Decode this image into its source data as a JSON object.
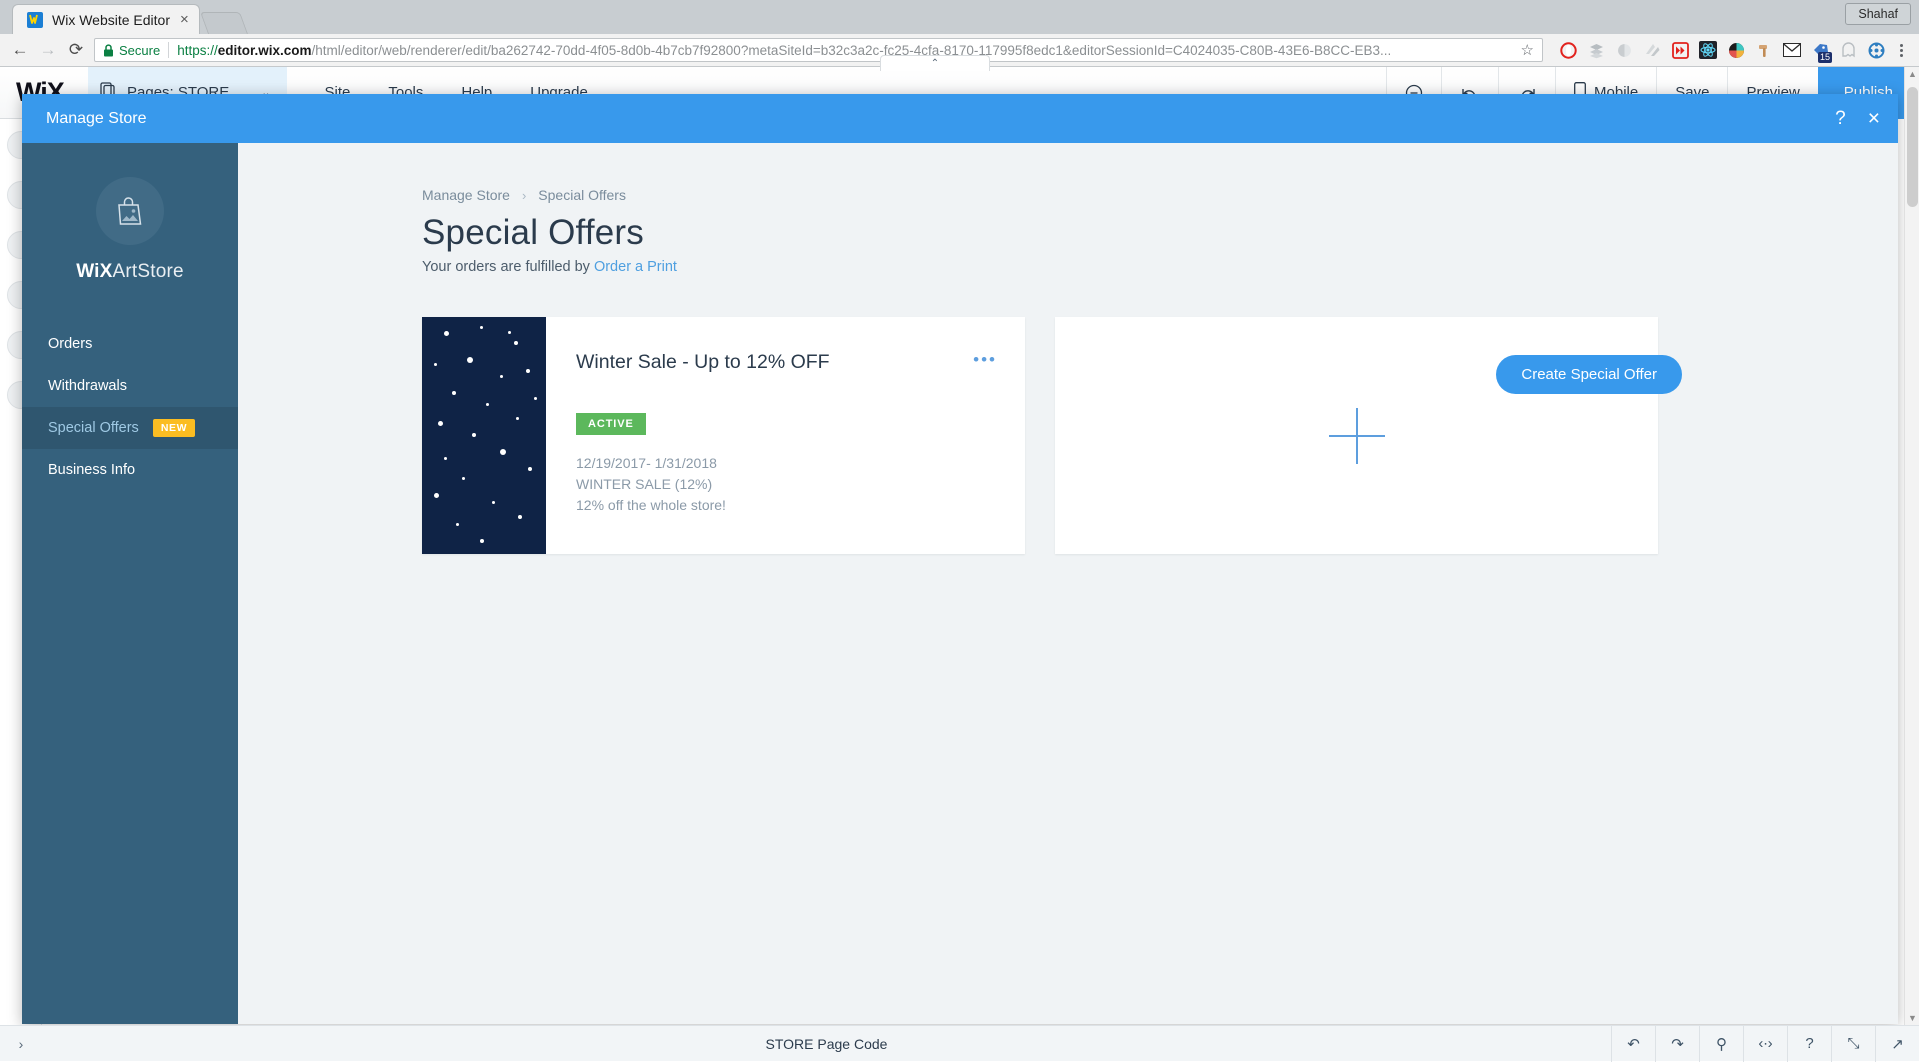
{
  "browser": {
    "tab": {
      "title": "Wix Website Editor",
      "favicon": "wix-favicon",
      "close": "×"
    },
    "new_tab_label": "",
    "profile": "Shahaf",
    "nav": {
      "back": "←",
      "forward": "→",
      "reload": "⟳"
    },
    "omnibox": {
      "secure_label": "Secure",
      "lock": "lock-icon",
      "url_scheme": "https://",
      "url_host": "editor.wix.com",
      "url_path": "/html/editor/web/renderer/edit/ba262742-70dd-4f05-8d0b-4b7cb7f92800?metaSiteId=b32c3a2c-fc25-4cfa-8170-117995f8edc1&editorSessionId=C4024035-C80B-43E6-B8CC-EB3...",
      "bookmark": "☆"
    },
    "extensions": [
      {
        "name": "opera-touch-icon"
      },
      {
        "name": "layers-icon"
      },
      {
        "name": "moon-icon"
      },
      {
        "name": "pages-icon"
      },
      {
        "name": "fast-forward-icon"
      },
      {
        "name": "react-devtools-icon"
      },
      {
        "name": "color-wheel-icon"
      },
      {
        "name": "hammer-icon"
      },
      {
        "name": "mail-icon"
      },
      {
        "name": "tag-icon",
        "badge": "15"
      },
      {
        "name": "ghost-icon"
      },
      {
        "name": "wheel-icon"
      }
    ],
    "menu": "chrome-menu-icon"
  },
  "editor": {
    "logo": "WiX",
    "pages_label": "Pages: STORE",
    "pages_chevron": "⌄",
    "menus": [
      "Site",
      "Tools",
      "Help",
      "Upgrade"
    ],
    "toolbar_handle": "⌃",
    "right_tools": [
      {
        "name": "zoom-out-icon",
        "label": ""
      },
      {
        "name": "undo-icon",
        "label": ""
      },
      {
        "name": "redo-icon",
        "label": ""
      },
      {
        "name": "mobile-icon",
        "label": "Mobile"
      },
      {
        "name": "save-button",
        "label": "Save"
      },
      {
        "name": "preview-button",
        "label": "Preview"
      }
    ],
    "publish_label": "Publish"
  },
  "modal": {
    "title": "Manage Store",
    "help_icon": "?",
    "close_icon": "×"
  },
  "sidebar": {
    "avatar_icon": "shopping-bag-icon",
    "brand_bold": "WiX",
    "brand_light": "ArtStore",
    "items": [
      {
        "label": "Orders",
        "active": false,
        "badge": null
      },
      {
        "label": "Withdrawals",
        "active": false,
        "badge": null
      },
      {
        "label": "Special Offers",
        "active": true,
        "badge": "NEW"
      },
      {
        "label": "Business Info",
        "active": false,
        "badge": null
      }
    ]
  },
  "content": {
    "breadcrumb": {
      "parent": "Manage Store",
      "separator": "›",
      "current": "Special Offers"
    },
    "page_title": "Special Offers",
    "subtitle_prefix": "Your orders are fulfilled by ",
    "subtitle_link": "Order a Print",
    "create_button": "Create Special Offer",
    "offers": [
      {
        "title": "Winter Sale - Up to 12% OFF",
        "menu_icon": "•••",
        "status": "ACTIVE",
        "status_color": "#5cb85c",
        "date_range": "12/19/2017- 1/31/2018",
        "coupon": "WINTER SALE (12%)",
        "description": "12% off the whole store!"
      }
    ],
    "add_card_icon": "plus-icon"
  },
  "bottom_bar": {
    "left_icon": "›",
    "page_code_label": "STORE Page Code",
    "tools": [
      {
        "name": "undo-icon",
        "glyph": "↶"
      },
      {
        "name": "redo-icon",
        "glyph": "↷"
      },
      {
        "name": "search-icon",
        "glyph": "⚲"
      },
      {
        "name": "code-icon",
        "glyph": "‹∙›"
      },
      {
        "name": "help-icon",
        "glyph": "?"
      },
      {
        "name": "expand-icon",
        "glyph": "⤡"
      },
      {
        "name": "open-icon",
        "glyph": "↗"
      }
    ]
  },
  "colors": {
    "accent": "#3899ec",
    "sidebar": "#35617d",
    "sidebar_active": "#2f566f",
    "badge_new": "#fbbd22",
    "status_active": "#5cb85c",
    "thumb_bg": "#0f2346"
  }
}
